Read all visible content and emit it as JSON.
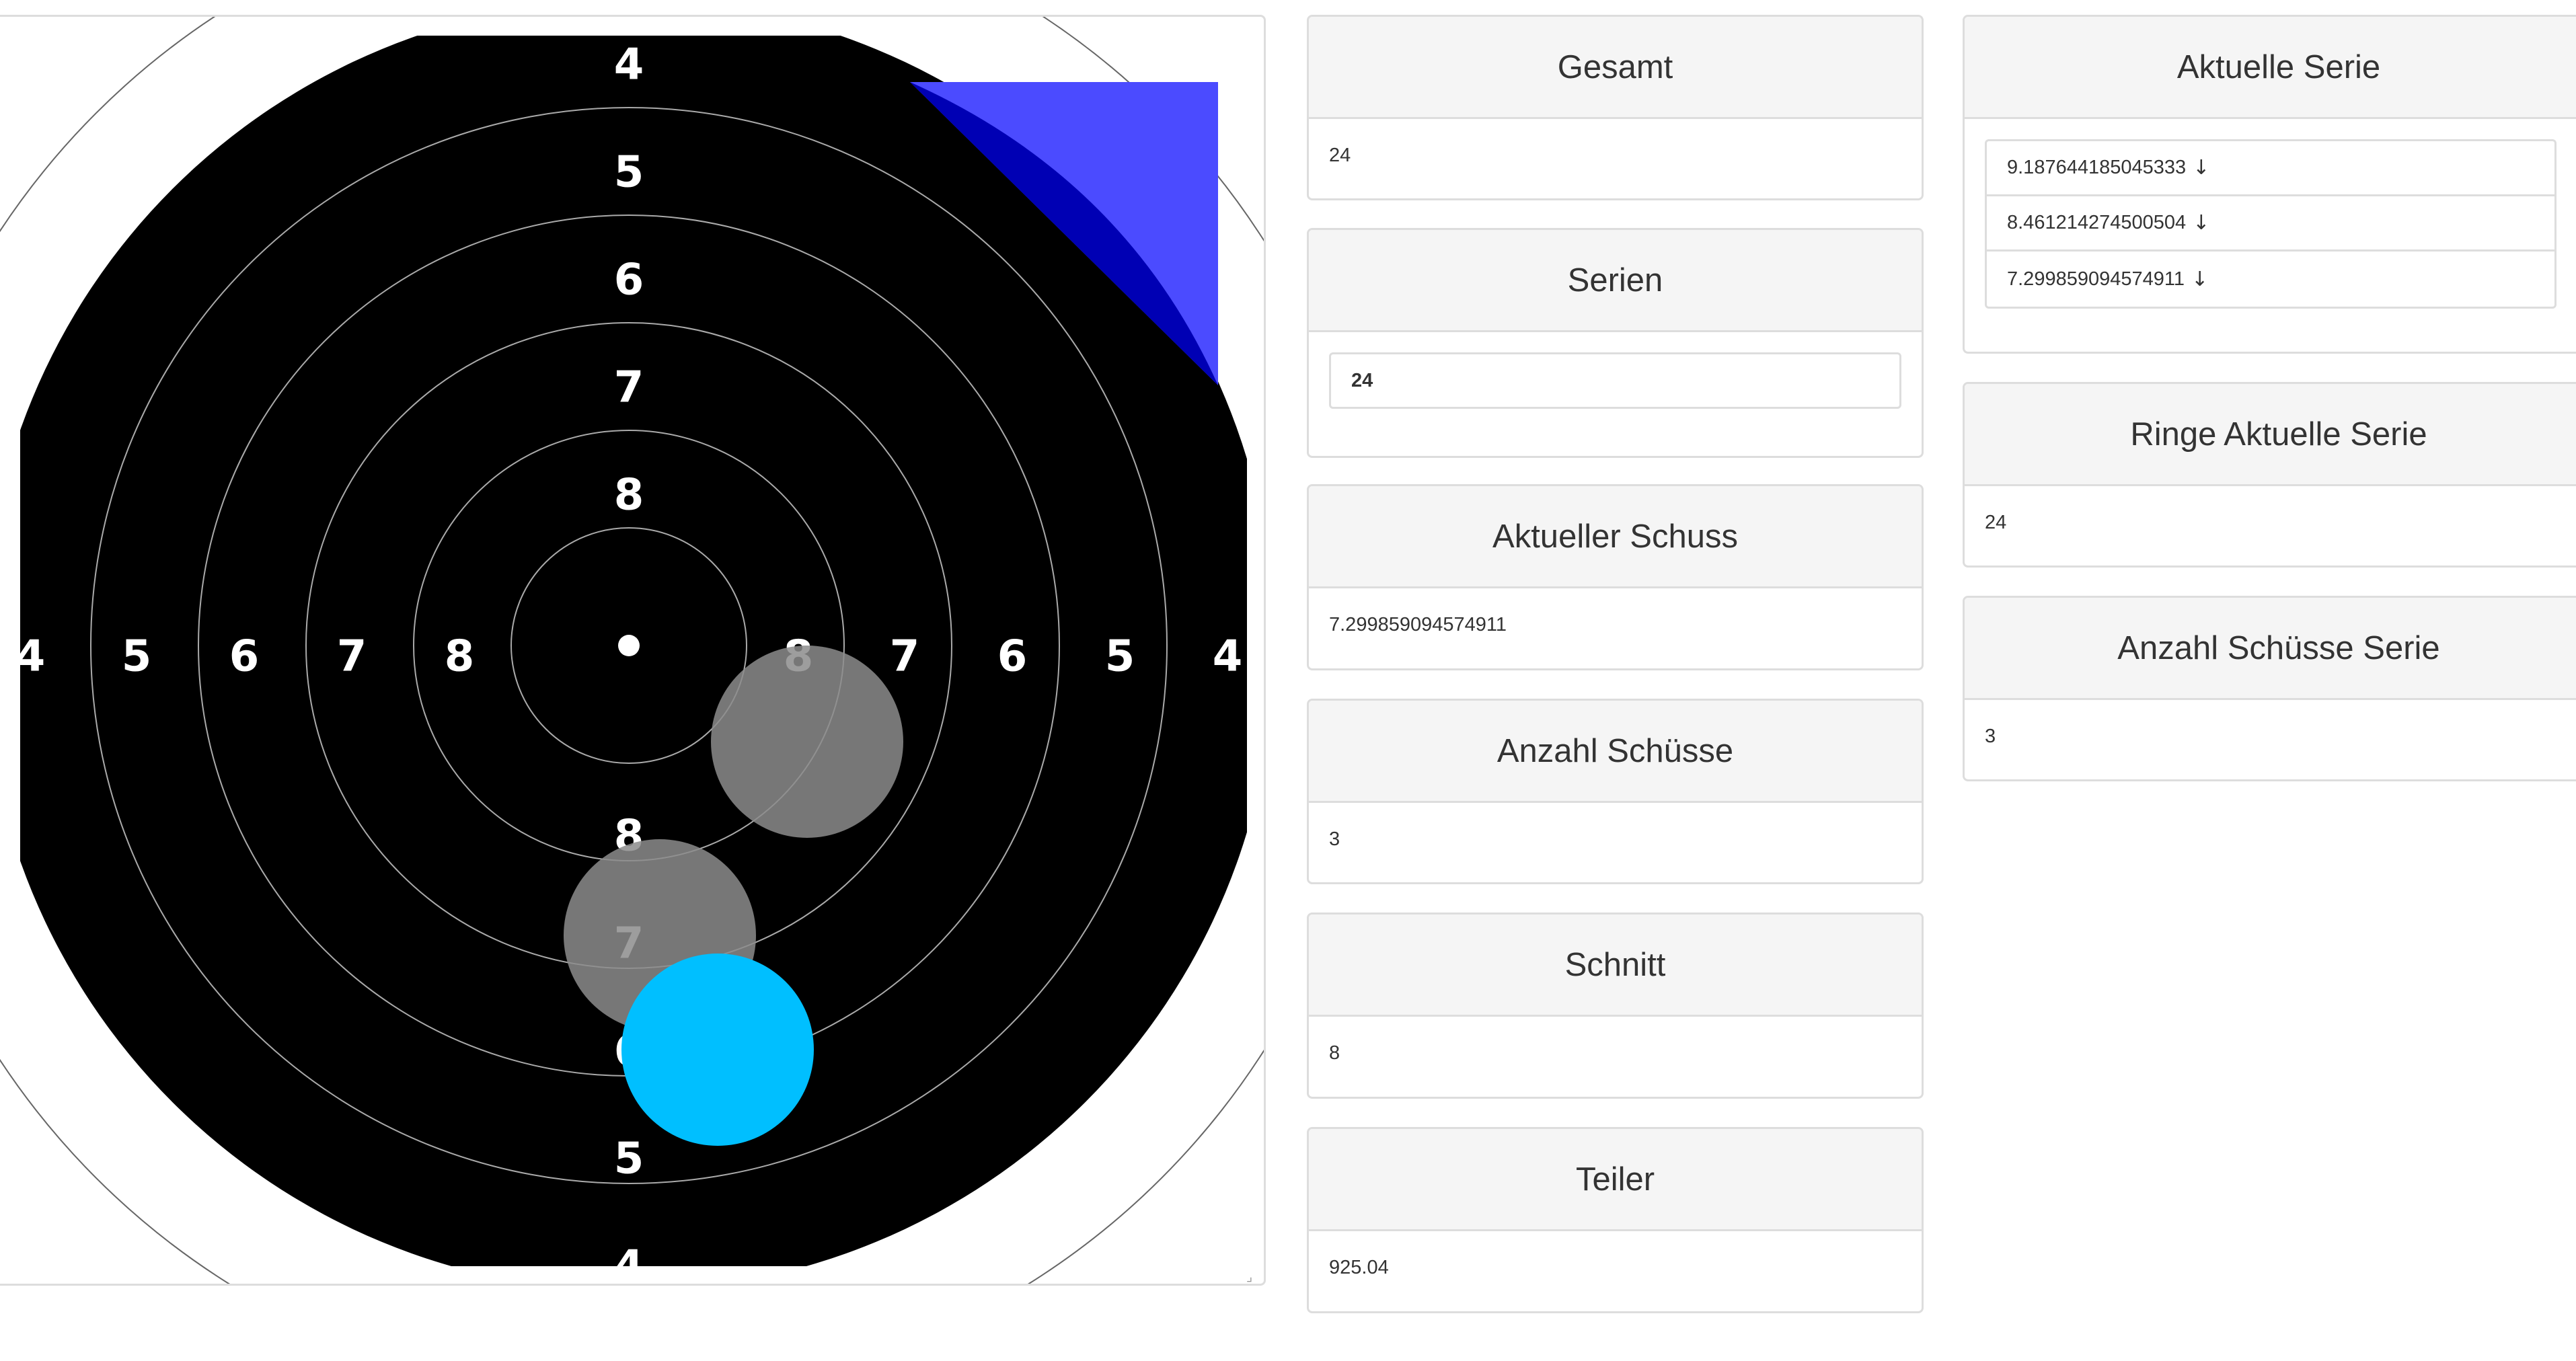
{
  "target": {
    "ring_labels_top": [
      "4",
      "5",
      "6",
      "7",
      "8"
    ],
    "ring_labels_bottom": [
      "8",
      "7",
      "6",
      "5",
      "4"
    ],
    "ring_labels_left": [
      "4",
      "5",
      "6",
      "7",
      "8"
    ],
    "ring_labels_right": [
      "8",
      "7",
      "6",
      "5",
      "4"
    ],
    "hits": [
      {
        "label": "previous shot",
        "color": "#8c8c8c"
      },
      {
        "label": "previous shot",
        "color": "#8c8c8c"
      },
      {
        "label": "current shot",
        "color": "#00bfff"
      }
    ],
    "corner_indicator_colors": {
      "light": "#4b4bff",
      "dark": "#0000b4"
    },
    "target_black": "#000000",
    "ring_line": "#aaaaaa"
  },
  "stats": {
    "gesamt": {
      "title": "Gesamt",
      "value": "24"
    },
    "serien": {
      "title": "Serien",
      "value": "24"
    },
    "aktueller_schuss": {
      "title": "Aktueller Schuss",
      "value": "7.299859094574911"
    },
    "anzahl_schuesse": {
      "title": "Anzahl Schüsse",
      "value": "3"
    },
    "schnitt": {
      "title": "Schnitt",
      "value": "8"
    },
    "teiler": {
      "title": "Teiler",
      "value": "925.04"
    },
    "aktuelle_serie": {
      "title": "Aktuelle Serie",
      "items": [
        {
          "value": "9.187644185045333",
          "arrow": "↓"
        },
        {
          "value": "8.461214274500504",
          "arrow": "↓"
        },
        {
          "value": "7.299859094574911",
          "arrow": "↓"
        }
      ]
    },
    "ringe_aktuelle_serie": {
      "title": "Ringe Aktuelle Serie",
      "value": "24"
    },
    "anzahl_schuesse_serie": {
      "title": "Anzahl Schüsse Serie",
      "value": "3"
    }
  }
}
